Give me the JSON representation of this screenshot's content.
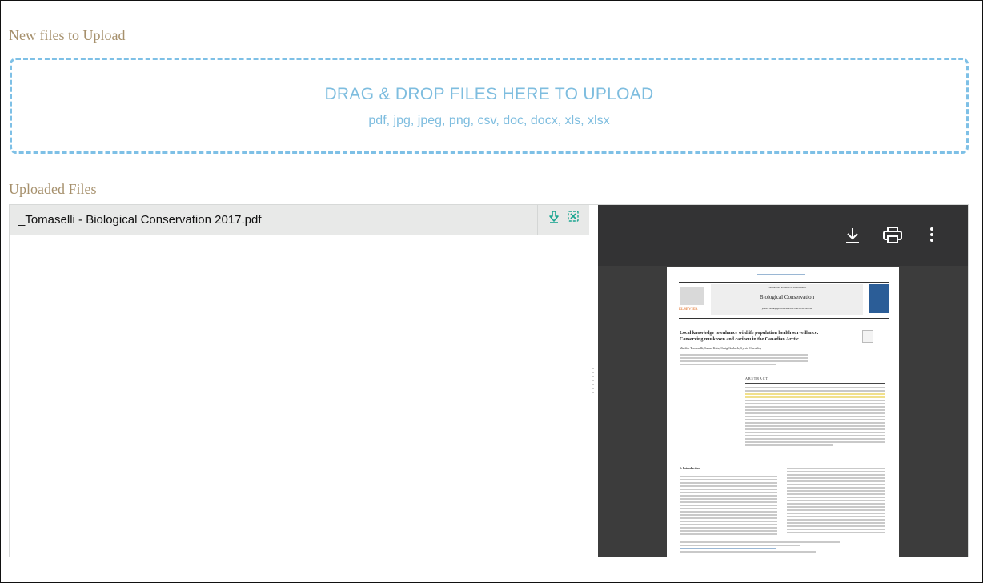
{
  "sections": {
    "new_files_title": "New files to Upload",
    "uploaded_title": "Uploaded Files"
  },
  "dropzone": {
    "title": "DRAG & DROP FILES HERE TO UPLOAD",
    "formats": "pdf, jpg, jpeg, png, csv, doc, docx, xls, xlsx"
  },
  "files": [
    {
      "name": "_Tomaselli - Biological Conservation 2017.pdf",
      "actions": [
        "download-icon",
        "remove-icon"
      ]
    }
  ],
  "viewer": {
    "toolbar_icons": [
      "download-icon",
      "print-icon",
      "more-vert-icon"
    ],
    "page": {
      "header_top": "Contents lists available at ScienceDirect",
      "journal": "Biological Conservation",
      "homepage": "journal homepage: www.elsevier.com/locate/biocon",
      "publisher": "ELSEVIER",
      "article_title_1": "Local knowledge to enhance wildlife population health surveillance:",
      "article_title_2": "Conserving muskoxen and caribou in the Canadian Arctic",
      "authors": "Matilde Tomaselli, Susan Kutz, Craig Gerlach, Sylvia Checkley",
      "abstract_heading": "ABSTRACT",
      "intro_heading": "1. Introduction"
    }
  },
  "colors": {
    "title_gold": "#a6906c",
    "dropzone_blue": "#7ebddf",
    "action_teal": "#1aa590",
    "viewer_bg": "#3c3c3c"
  }
}
